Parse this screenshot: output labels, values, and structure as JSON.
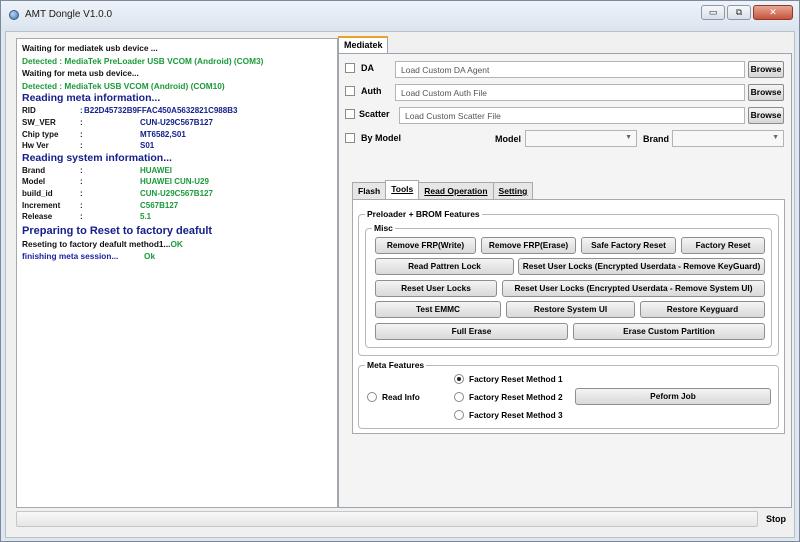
{
  "window": {
    "title": "AMT Dongle V1.0.0",
    "buttons": [
      "▭",
      "⧉",
      "✕"
    ]
  },
  "log": {
    "lines": [
      {
        "text": "Waiting for mediatek usb device ...",
        "color": "black"
      },
      {
        "text": "Detected   :   MediaTek PreLoader USB VCOM (Android) (COM3)",
        "color": "green"
      },
      {
        "text": "Waiting for meta usb device...",
        "color": "black"
      },
      {
        "text": "Detected   :   MediaTek USB VCOM (Android) (COM10)",
        "color": "green"
      }
    ],
    "meta_heading": "Reading meta information...",
    "meta": [
      {
        "key": "RID",
        "sep": ":",
        "value": "B22D45732B9FFAC450A5632821C988B3",
        "blue": true
      },
      {
        "key": "SW_VER",
        "sep": ":",
        "value": "CUN-U29C567B127"
      },
      {
        "key": "Chip type",
        "sep": ":",
        "value": "MT6582,S01"
      },
      {
        "key": "Hw Ver",
        "sep": ":",
        "value": "S01"
      }
    ],
    "system_heading": "Reading system information...",
    "system": [
      {
        "key": "Brand",
        "sep": ":",
        "value": "HUAWEI"
      },
      {
        "key": "Model",
        "sep": ":",
        "value": "HUAWEI CUN-U29"
      },
      {
        "key": "build_id",
        "sep": ":",
        "value": "CUN-U29C567B127"
      },
      {
        "key": "Increment",
        "sep": ":",
        "value": "C567B127"
      },
      {
        "key": "Release",
        "sep": ":",
        "value": "5.1"
      }
    ],
    "reset_heading": "Preparing to Reset to factory deafult",
    "reset_line1": "Reseting to factory deafult method1...",
    "reset_line1_ok": "OK",
    "reset_line2": "finishing meta session...",
    "reset_line2_ok": "Ok"
  },
  "mediatek_tab": "Mediatek",
  "fields": {
    "da": {
      "label": "DA",
      "placeholder": "Load Custom DA Agent"
    },
    "auth": {
      "label": "Auth",
      "placeholder": "Load Custom Auth File"
    },
    "scatter": {
      "label": "Scatter",
      "placeholder": "Load Custom Scatter File"
    },
    "browse_label": "Browse",
    "by_model": "By Model",
    "model_label": "Model",
    "brand_label": "Brand"
  },
  "subtabs": [
    "Flash",
    "Tools",
    "Read Operation",
    "Setting"
  ],
  "preloader": {
    "title": "Preloader + BROM Features",
    "misc_title": "Misc",
    "buttons": [
      "Remove FRP(Write)",
      "Remove FRP(Erase)",
      "Safe Factory Reset",
      "Factory Reset",
      "Read Pattren Lock",
      "Reset User Locks (Encrypted Userdata - Remove KeyGuard)",
      "Reset User Locks",
      "Reset User Locks (Encrypted Userdata - Remove System UI)",
      "Test EMMC",
      "Restore System UI",
      "Restore Keyguard",
      "Full Erase",
      "Erase Custom Partition"
    ]
  },
  "meta_features": {
    "title": "Meta Features",
    "read_info": "Read Info",
    "methods": [
      "Factory Reset Method 1",
      "Factory Reset Method 2",
      "Factory Reset Method 3"
    ],
    "perform_job": "Peform Job"
  },
  "stop_label": "Stop"
}
